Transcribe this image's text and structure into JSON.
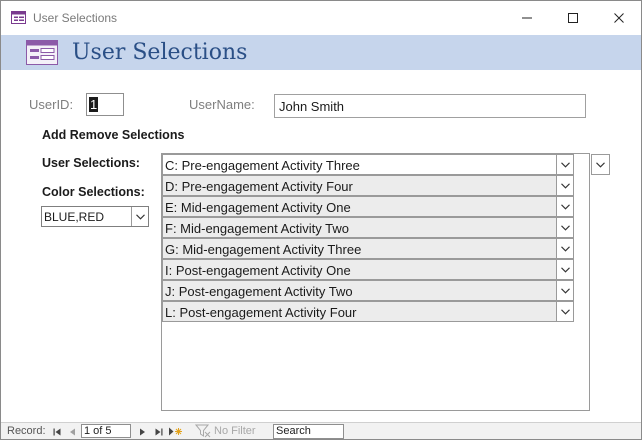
{
  "window": {
    "title": "User Selections",
    "icon": "form-icon",
    "controls": [
      "minimize-icon",
      "maximize-icon",
      "close-icon"
    ]
  },
  "header": {
    "title": "User Selections",
    "icon": "form-icon",
    "band_color": "#c6d5ec",
    "title_color": "#2a4f86"
  },
  "form": {
    "userid_label": "UserID:",
    "userid_value": "1",
    "username_label": "UserName:",
    "username_value": "John Smith",
    "section_label": "Add Remove Selections",
    "user_selections_label": "User Selections:",
    "color_selections_label": "Color Selections:",
    "color_value": "BLUE,RED"
  },
  "selections": [
    {
      "label": "C: Pre-engagement Activity Three"
    },
    {
      "label": "D: Pre-engagement Activity Four"
    },
    {
      "label": "E: Mid-engagement Activity One"
    },
    {
      "label": "F: Mid-engagement Activity Two"
    },
    {
      "label": "G: Mid-engagement Activity Three"
    },
    {
      "label": "I: Post-engagement Activity One"
    },
    {
      "label": "J: Post-engagement Activity Two"
    },
    {
      "label": "L: Post-engagement Activity Four"
    }
  ],
  "record_nav": {
    "label": "Record:",
    "position": "1 of 5",
    "filter": "No Filter",
    "search": "Search"
  }
}
